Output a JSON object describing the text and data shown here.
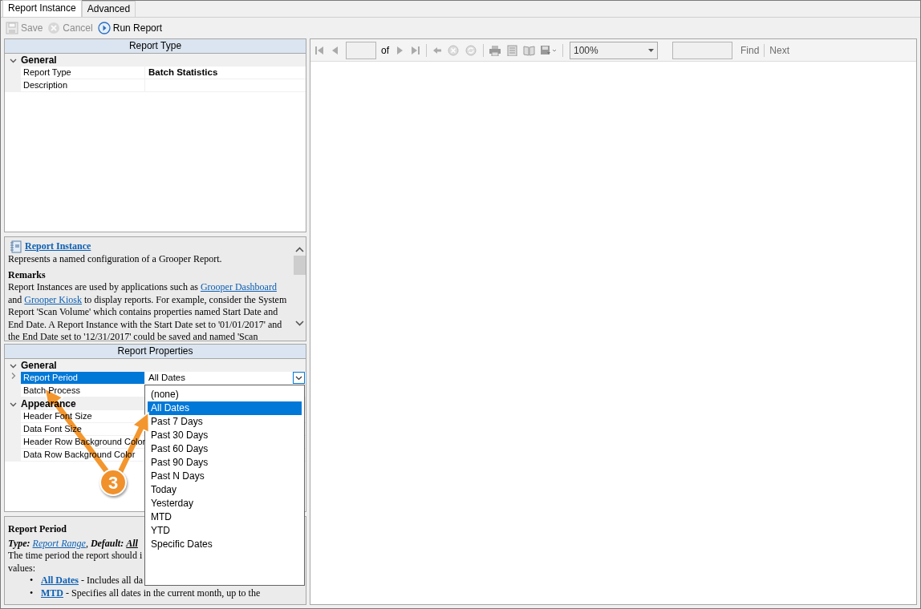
{
  "tabs": [
    {
      "label": "Report Instance",
      "selected": true
    },
    {
      "label": "Advanced",
      "selected": false
    }
  ],
  "toolbar": [
    {
      "label": "Save",
      "kind": "save",
      "disabled": true
    },
    {
      "label": "Cancel",
      "kind": "cancel",
      "disabled": true
    },
    {
      "label": "Run Report",
      "kind": "run",
      "disabled": false
    }
  ],
  "report_type": {
    "title": "Report Type",
    "categories": [
      {
        "name": "General",
        "expanded": true,
        "properties": [
          {
            "name": "Report Type",
            "value": "Batch Statistics",
            "selected": false
          },
          {
            "name": "Description",
            "selected": false
          }
        ]
      }
    ]
  },
  "instance_help": {
    "title": "Report Instance",
    "summary": "Represents a named configuration of a Grooper Report.",
    "remarks_heading": "Remarks",
    "remarks": [
      {
        "kind": "text",
        "text": "Report Instances are used by applications such as "
      },
      {
        "kind": "link",
        "text": "Grooper Dashboard"
      },
      {
        "kind": "text",
        "text": " and "
      },
      {
        "kind": "link",
        "text": "Grooper Kiosk"
      },
      {
        "kind": "text",
        "text": " to display reports. For example, consider the System Report 'Scan Volume' which contains properties named Start Date and End Date. A Report Instance with the Start Date set to '01/01/2017' and the End Date set to '12/31/2017' could be saved and named 'Scan"
      }
    ]
  },
  "report_properties": {
    "title": "Report Properties",
    "categories": [
      {
        "name": "General",
        "expanded": true,
        "properties": [
          {
            "name": "Report Period",
            "value": "All Dates",
            "selected": true,
            "expandable": true,
            "dropdown_open": true
          },
          {
            "name": "Batch Process",
            "selected": false
          }
        ]
      },
      {
        "name": "Appearance",
        "expanded": true,
        "properties": [
          {
            "name": "Header Font Size",
            "selected": false
          },
          {
            "name": "Data Font Size",
            "selected": false
          },
          {
            "name": "Header Row Background Color",
            "selected": false
          },
          {
            "name": "Data Row Background Color",
            "selected": false
          }
        ]
      }
    ]
  },
  "dropdown_options": [
    {
      "label": "(none)",
      "selected": false
    },
    {
      "label": "All Dates",
      "selected": true
    },
    {
      "label": "Past 7 Days",
      "selected": false
    },
    {
      "label": "Past 30 Days",
      "selected": false
    },
    {
      "label": "Past 60 Days",
      "selected": false
    },
    {
      "label": "Past 90 Days",
      "selected": false
    },
    {
      "label": "Past N Days",
      "selected": false
    },
    {
      "label": "Today",
      "selected": false
    },
    {
      "label": "Yesterday",
      "selected": false
    },
    {
      "label": "MTD",
      "selected": false
    },
    {
      "label": "YTD",
      "selected": false
    },
    {
      "label": "Specific Dates",
      "selected": false
    }
  ],
  "property_help": {
    "title": "Report Period",
    "type_label": "Type:",
    "type_link": "Report Range",
    "separator": ",",
    "default_label": "Default:",
    "default_link": "All",
    "lines": [
      "The time period the report should i",
      "values:"
    ],
    "bullets": [
      {
        "bullet": "•",
        "link": "All Dates",
        "text": " - Includes all da"
      },
      {
        "bullet": "•",
        "link": "MTD",
        "text": " - Specifies all dates in the current month, up to the"
      }
    ]
  },
  "viewer": {
    "of_label": "of",
    "zoom": "100%",
    "find_label": "Find",
    "next_label": "Next"
  },
  "callout": {
    "label": "3"
  }
}
